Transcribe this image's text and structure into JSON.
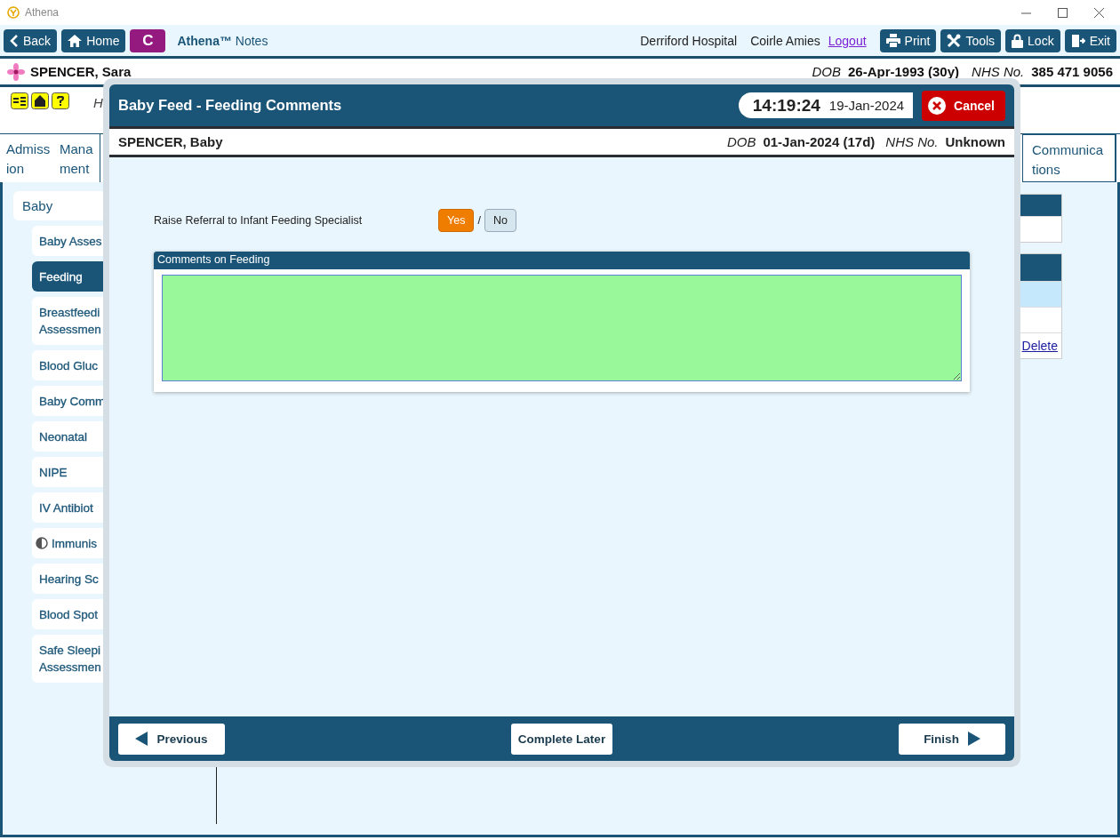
{
  "window": {
    "title": "Athena"
  },
  "toolbar": {
    "buttons": [
      {
        "label": "Back",
        "kind": "back"
      },
      {
        "label": "Home",
        "kind": "home"
      },
      {
        "label": "C",
        "kind": "letter"
      }
    ],
    "app_name": "Athena™",
    "app_suffix": "Notes",
    "site": "Derriford Hospital",
    "user": "Coirle Amies",
    "logout": "Logout",
    "actions": [
      {
        "label": "Print",
        "kind": "print"
      },
      {
        "label": "Tools",
        "kind": "tools"
      },
      {
        "label": "Lock",
        "kind": "lock"
      },
      {
        "label": "Exit",
        "kind": "exit"
      }
    ]
  },
  "patient": {
    "name": "SPENCER, Sara",
    "dob_label": "DOB",
    "dob": "26-Apr-1993 (30y)",
    "nhs_label": "NHS No.",
    "nhs": "385 471 9056"
  },
  "alerts": {
    "text": "H"
  },
  "tabs": [
    {
      "lines": [
        "Admiss",
        "ion"
      ]
    },
    {
      "lines": [
        "Mana",
        "ment"
      ]
    },
    {
      "lines": [
        "Communica",
        "tions"
      ]
    }
  ],
  "sidebar": {
    "group": "Baby",
    "items": [
      {
        "lines": [
          "Baby Asses"
        ],
        "selected": false,
        "kind": "plain"
      },
      {
        "lines": [
          "Feeding"
        ],
        "selected": true,
        "kind": "plain"
      },
      {
        "lines": [
          "Breastfeedi",
          "Assessmen"
        ],
        "selected": false,
        "kind": "plain"
      },
      {
        "lines": [
          "Blood Gluc"
        ],
        "selected": false,
        "kind": "plain"
      },
      {
        "lines": [
          "Baby Comm"
        ],
        "selected": false,
        "kind": "plain"
      },
      {
        "lines": [
          "Neonatal"
        ],
        "selected": false,
        "kind": "plain"
      },
      {
        "lines": [
          "NIPE"
        ],
        "selected": false,
        "kind": "plain"
      },
      {
        "lines": [
          "IV Antibiot"
        ],
        "selected": false,
        "kind": "plain"
      },
      {
        "lines": [
          "Immunis"
        ],
        "selected": false,
        "kind": "partial"
      },
      {
        "lines": [
          "Hearing Sc"
        ],
        "selected": false,
        "kind": "plain"
      },
      {
        "lines": [
          "Blood Spot"
        ],
        "selected": false,
        "kind": "plain"
      },
      {
        "lines": [
          "Safe Sleepi",
          "Assessmen"
        ],
        "selected": false,
        "kind": "plain"
      }
    ]
  },
  "side_table": {
    "tables": [
      {
        "rows": [
          {
            "selected": false
          }
        ]
      },
      {
        "rows": [
          {
            "selected": true
          },
          {
            "selected": false
          },
          {
            "selected": false
          }
        ]
      }
    ],
    "link": "Delete"
  },
  "dialog": {
    "title": "Baby Feed - Feeding Comments",
    "time": "14:19:24",
    "date": "19-Jan-2024",
    "cancel": "Cancel",
    "patient": {
      "name": "SPENCER, Baby",
      "dob_label": "DOB",
      "dob": "01-Jan-2024 (17d)",
      "nhs_label": "NHS No.",
      "nhs": "Unknown"
    },
    "referral": {
      "label": "Raise Referral to Infant Feeding Specialist",
      "separator": "/",
      "options": [
        {
          "label": "Yes",
          "selected": true
        },
        {
          "label": "No",
          "selected": false
        }
      ]
    },
    "comments": {
      "title": "Comments on Feeding"
    },
    "footer": [
      {
        "label": "Previous",
        "kind": "previous"
      },
      {
        "label": "Complete Later",
        "kind": "plain"
      },
      {
        "label": "Finish",
        "kind": "next"
      }
    ]
  }
}
